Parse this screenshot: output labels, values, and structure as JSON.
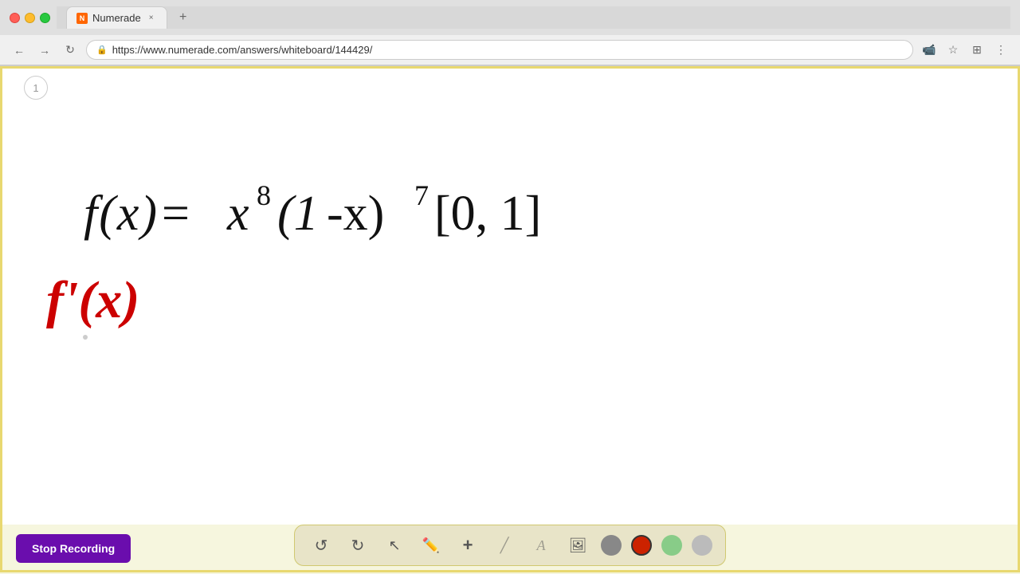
{
  "browser": {
    "tab_title": "Numerade",
    "tab_favicon_text": "N",
    "url": "https://www.numerade.com/answers/whiteboard/144429/",
    "nav": {
      "back": "←",
      "forward": "→",
      "refresh": "↻"
    }
  },
  "page": {
    "number": "1"
  },
  "toolbar": {
    "stop_recording_label": "Stop Recording",
    "tools": [
      {
        "name": "undo",
        "symbol": "↺"
      },
      {
        "name": "redo",
        "symbol": "↻"
      },
      {
        "name": "select",
        "symbol": "↖"
      },
      {
        "name": "pen",
        "symbol": "✏"
      },
      {
        "name": "plus",
        "symbol": "+"
      },
      {
        "name": "eraser",
        "symbol": "/"
      },
      {
        "name": "text",
        "symbol": "A"
      },
      {
        "name": "image",
        "symbol": "🖼"
      }
    ],
    "colors": [
      {
        "name": "gray",
        "hex": "#888888"
      },
      {
        "name": "red",
        "hex": "#cc2200"
      },
      {
        "name": "light-green",
        "hex": "#88cc88"
      },
      {
        "name": "light-gray",
        "hex": "#bbbbbb"
      }
    ]
  },
  "whiteboard": {
    "formula_main": "f(x) = x⁸(1-x)⁷  [0, 1]",
    "formula_derivative": "f'(x)"
  }
}
